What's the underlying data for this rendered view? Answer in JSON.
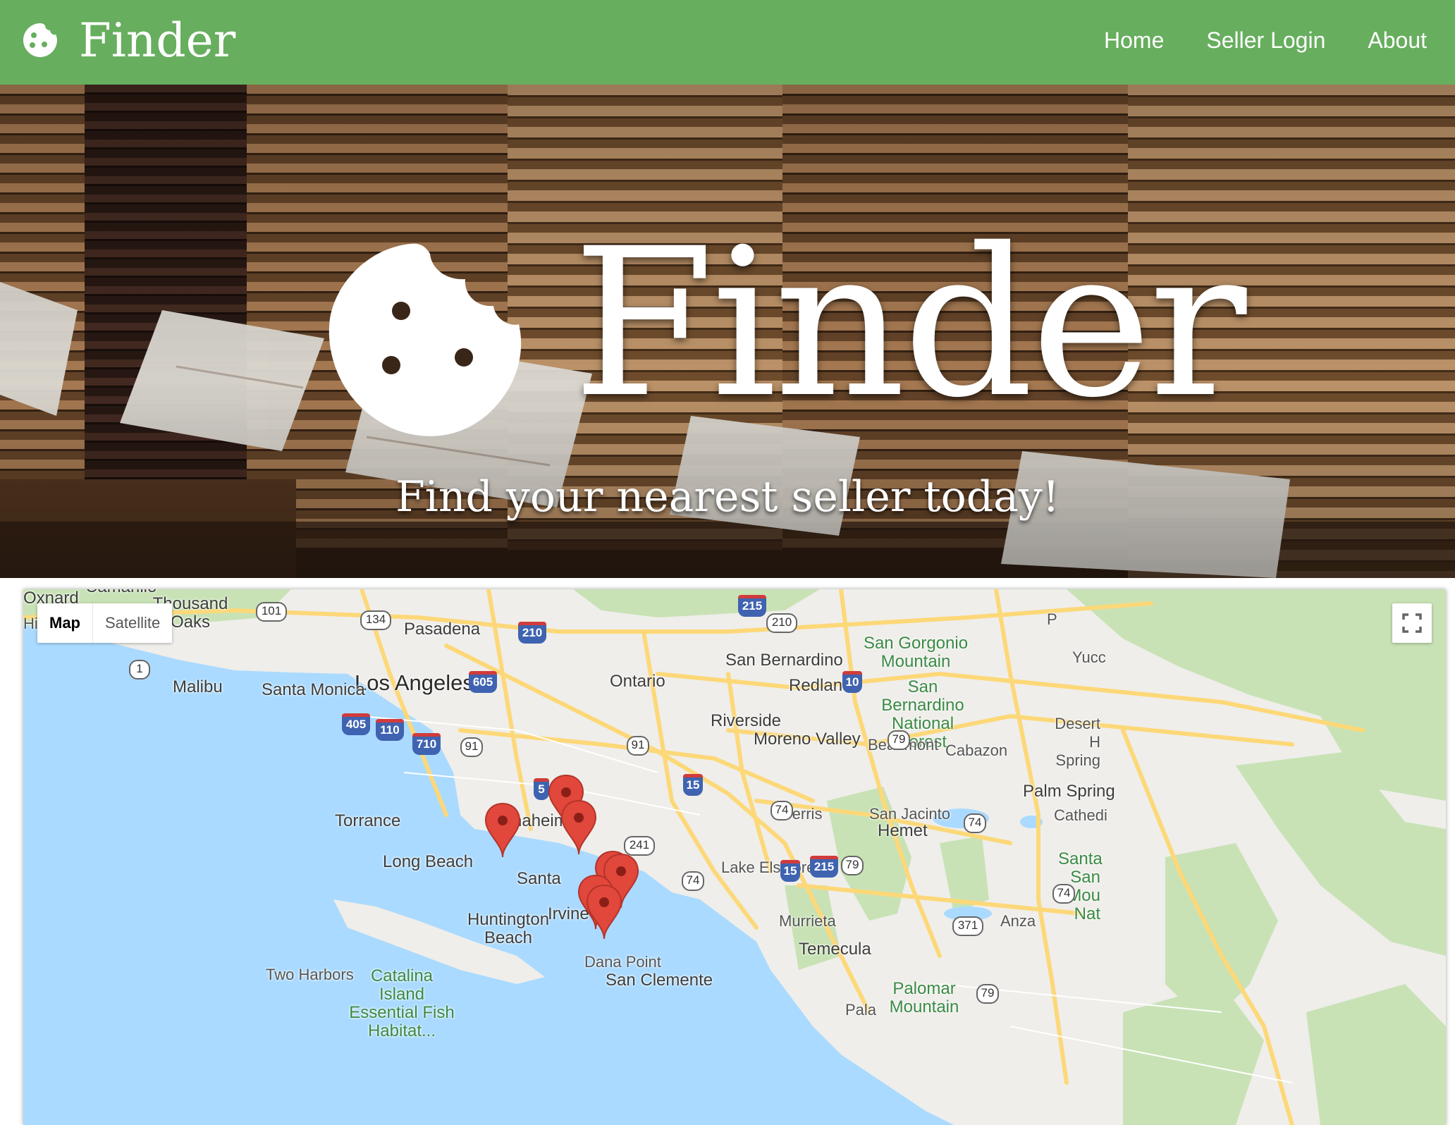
{
  "nav": {
    "brand": "Finder",
    "links": [
      "Home",
      "Seller Login",
      "About"
    ]
  },
  "hero": {
    "title": "Finder",
    "subtitle": "Find your nearest seller today!"
  },
  "map": {
    "controls": {
      "map_label": "Map",
      "satellite_label": "Satellite",
      "active": "Map"
    },
    "labels": {
      "oxnard": "Oxnard",
      "camarillo": "Camarillo",
      "thousand_oaks": "Thousand Oaks",
      "pasadena": "Pasadena",
      "los_angeles": "Los Angeles",
      "malibu": "Malibu",
      "santa_monica": "Santa Monica",
      "torrance": "Torrance",
      "long_beach": "Long Beach",
      "anaheim": "Anaheim",
      "santa_ana": "Santa",
      "huntington_beach": "Huntington Beach",
      "irvine": "Irvine",
      "ontario": "Ontario",
      "san_bernardino": "San Bernardino",
      "redlands": "Redlands",
      "riverside": "Riverside",
      "moreno_valley": "Moreno Valley",
      "perris": "Perris",
      "lake_elsinore": "Lake Elsinore",
      "murrieta": "Murrieta",
      "temecula": "Temecula",
      "dana_point": "Dana Point",
      "san_clemente": "San Clemente",
      "two_harbors": "Two Harbors",
      "catalina": "Catalina Island Essential Fish Habitat...",
      "san_gorgonio": "San Gorgonio Mountain",
      "san_bernardino_nf": "San Bernardino National Forest",
      "beaumont": "Beaumont",
      "cabazon": "Cabazon",
      "san_jacinto": "San Jacinto",
      "hemet": "Hemet",
      "palm_springs": "Palm Spring",
      "cathedral": "Cathedi",
      "desert_hot_springs": "Desert H Spring",
      "anza": "Anza",
      "palomar": "Palomar Mountain",
      "pala": "Pala",
      "yucca": "Yucc",
      "santa_rosa": "Santa San Mou Nat",
      "hi": "Hi",
      "pe": "P"
    },
    "markers": [
      "seller-pin",
      "seller-pin",
      "seller-pin",
      "seller-pin",
      "seller-pin",
      "seller-pin",
      "seller-pin"
    ],
    "colors": {
      "water": "#aadaff",
      "land": "#efeeea",
      "park": "#c8e2b5",
      "road": "#fdd878",
      "marker": "#e2473b",
      "nav": "#67ae5e"
    }
  }
}
